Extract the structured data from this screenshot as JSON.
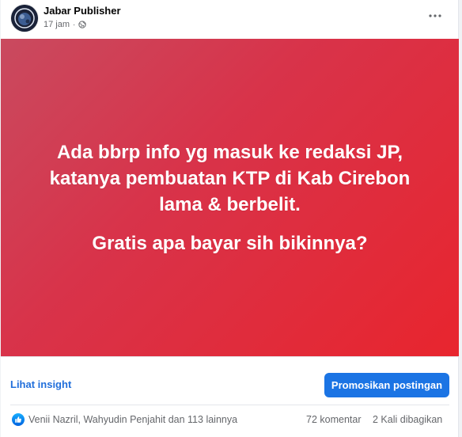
{
  "post": {
    "author": "Jabar Publisher",
    "timestamp": "17 jam",
    "separator": "·",
    "privacy_icon": "globe-icon",
    "more_icon": "more-horizontal-icon",
    "background_colors": [
      "#c94a5f",
      "#e8252e"
    ],
    "text_color": "#ffffff",
    "body": {
      "paragraph1": [
        "Ada bbrp info yg masuk ke redaksi JP,",
        "katanya pembuatan KTP di Kab Cirebon",
        "lama & berbelit."
      ],
      "paragraph2": "Gratis apa bayar sih bikinnya?"
    }
  },
  "actions": {
    "insight_label": "Lihat insight",
    "promote_label": "Promosikan postingan",
    "accent_color": "#1b74e4"
  },
  "engagement": {
    "reaction_icon": "like-icon",
    "reactions_text": "Venii Nazril, Wahyudin Penjahit dan 113 lainnya",
    "comments_text": "72 komentar",
    "shares_text": "2 Kali dibagikan"
  }
}
